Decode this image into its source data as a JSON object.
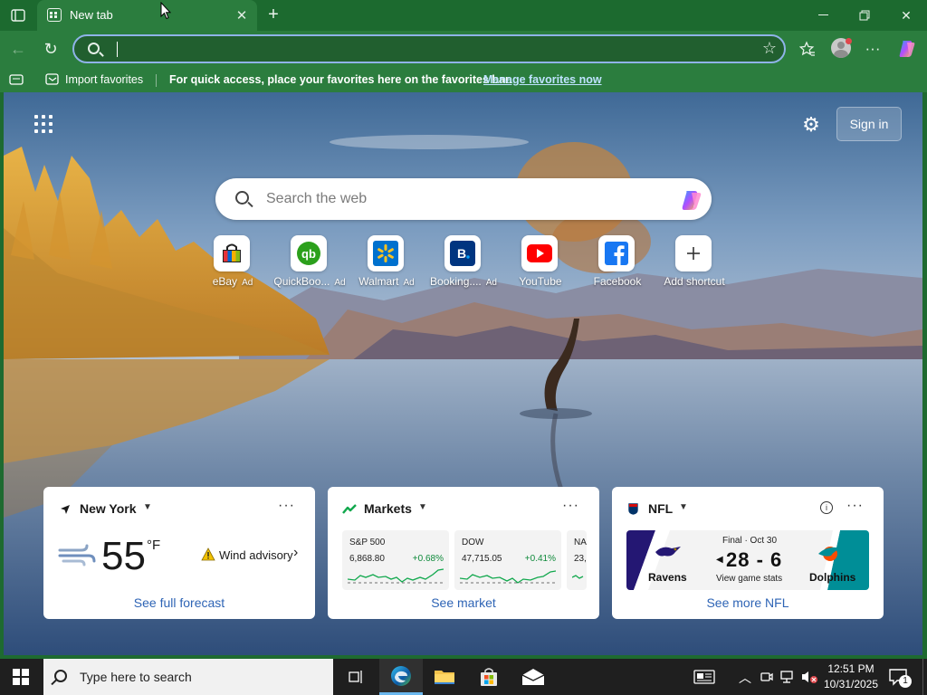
{
  "browser": {
    "tab_title": "New tab",
    "address_value": "",
    "favorites_bar": {
      "import_label": "Import favorites",
      "message": "For quick access, place your favorites here on the favorites bar.",
      "manage_link": "Manage favorites now"
    }
  },
  "newtab": {
    "signin_label": "Sign in",
    "search_placeholder": "Search the web",
    "shortcuts": [
      {
        "label": "eBay",
        "ad": "Ad",
        "icon": "ebay-bag-icon"
      },
      {
        "label": "QuickBoo...",
        "ad": "Ad",
        "icon": "quickbooks-icon"
      },
      {
        "label": "Walmart",
        "ad": "Ad",
        "icon": "walmart-spark-icon"
      },
      {
        "label": "Booking....",
        "ad": "Ad",
        "icon": "booking-icon"
      },
      {
        "label": "YouTube",
        "ad": "",
        "icon": "youtube-icon"
      },
      {
        "label": "Facebook",
        "ad": "",
        "icon": "facebook-icon"
      },
      {
        "label": "Add shortcut",
        "ad": "",
        "icon": "plus-icon"
      }
    ],
    "weather": {
      "location": "New York",
      "temperature": "55",
      "unit": "°F",
      "advisory": "Wind advisory",
      "link": "See full forecast"
    },
    "markets": {
      "title": "Markets",
      "items": [
        {
          "name": "S&P 500",
          "value": "6,868.80",
          "change": "+0.68%"
        },
        {
          "name": "DOW",
          "value": "47,715.05",
          "change": "+0.41%"
        },
        {
          "name": "NA",
          "value": "23,",
          "change": ""
        }
      ],
      "link": "See market"
    },
    "nfl": {
      "title": "NFL",
      "status": "Final · Oct 30",
      "score": "28 - 6",
      "stats": "View game stats",
      "team_left": "Ravens",
      "team_right": "Dolphins",
      "link": "See more NFL"
    }
  },
  "taskbar": {
    "search_placeholder": "Type here to search",
    "time": "12:51 PM",
    "date": "10/31/2025",
    "notification_count": "1"
  },
  "colors": {
    "browser_frame": "#1c6a2f",
    "toolbar": "#2b7d3e",
    "link_blue": "#2e64b5",
    "market_up": "#0f8a3b",
    "taskbar": "#1f1f1f"
  }
}
